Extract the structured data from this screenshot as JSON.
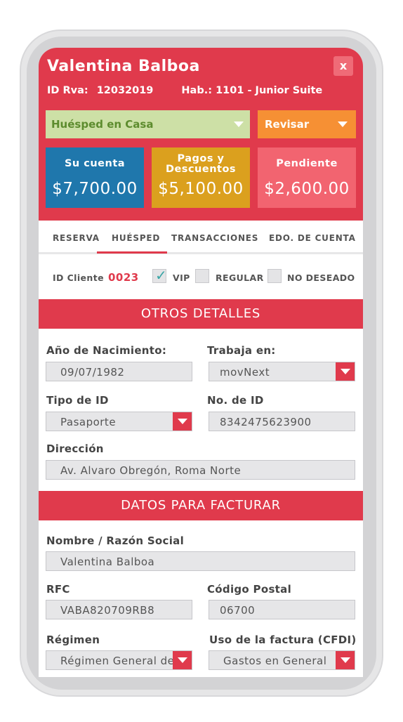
{
  "guest": {
    "name": "Valentina Balboa",
    "close_label": "x",
    "rva_label": "ID Rva:",
    "rva_value": "12032019",
    "room_label": "Hab.:",
    "room_value": "1101 - Junior Suite"
  },
  "status": {
    "selected": "Huésped en Casa",
    "review_label": "Revisar"
  },
  "cards": [
    {
      "label": "Su cuenta",
      "amount": "$7,700.00",
      "color": "#1f77ac"
    },
    {
      "label_line1": "Pagos y",
      "label_line2": "Descuentos",
      "amount": "$5,100.00",
      "color": "#dba01e"
    },
    {
      "label": "Pendiente",
      "amount": "$2,600.00",
      "color": "#f26470"
    }
  ],
  "tabs": [
    {
      "label": "RESERVA"
    },
    {
      "label": "HUÉSPED",
      "active": true
    },
    {
      "label": "TRANSACCIONES"
    },
    {
      "label": "EDO. DE CUENTA"
    }
  ],
  "client": {
    "id_label": "ID Cliente",
    "id_value": "0023",
    "options": [
      {
        "label": "VIP",
        "checked": true
      },
      {
        "label": "REGULAR",
        "checked": false
      },
      {
        "label": "NO DESEADO",
        "checked": false
      }
    ]
  },
  "otros": {
    "title": "OTROS DETALLES",
    "birth_label": "Año de Nacimiento:",
    "birth_value": "09/07/1982",
    "work_label": "Trabaja en:",
    "work_value": "movNext",
    "idtype_label": "Tipo de ID",
    "idtype_value": "Pasaporte",
    "idnum_label": "No. de ID",
    "idnum_value": "8342475623900",
    "address_label": "Dirección",
    "address_value": "Av. Alvaro Obregón, Roma Norte"
  },
  "factura": {
    "title": "DATOS PARA FACTURAR",
    "name_label": "Nombre / Razón Social",
    "name_value": "Valentina Balboa",
    "rfc_label": "RFC",
    "rfc_value": "VABA820709RB8",
    "cp_label": "Código Postal",
    "cp_value": "06700",
    "regimen_label": "Régimen",
    "regimen_value": "Régimen General de Ley",
    "uso_label": "Uso de la factura (CFDI)",
    "uso_value": "Gastos en General"
  },
  "colors": {
    "primary_red": "#e03a4c",
    "status_green_bg": "#cde0a6",
    "status_green_text": "#5d8c2e",
    "review_orange": "#f69034",
    "checkbox_teal": "#3aa6a6"
  }
}
